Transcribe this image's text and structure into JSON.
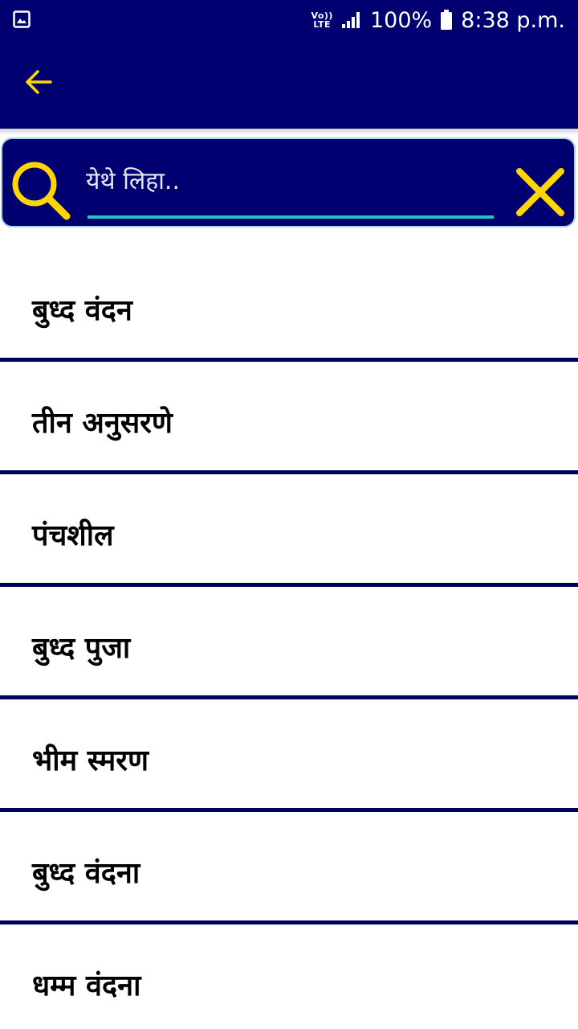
{
  "status_bar": {
    "gallery_icon": "image-icon",
    "volte_top": "Vo))",
    "volte_bottom": "LTE",
    "signal_icon": "signal-icon",
    "battery_percent": "100%",
    "battery_icon": "battery-icon",
    "time": "8:38 p.m."
  },
  "app_bar": {
    "back_icon": "arrow-left-icon",
    "accent_color": "#FFD600",
    "background_color": "#000070"
  },
  "search": {
    "placeholder": "येथे लिहा..",
    "value": "",
    "search_icon": "search-icon",
    "clear_icon": "close-icon",
    "underline_color": "#1FC7C9"
  },
  "list": {
    "items": [
      {
        "label": "बुध्द  वंदन"
      },
      {
        "label": "तीन अनुसरणे"
      },
      {
        "label": "पंचशील"
      },
      {
        "label": "बुध्द पुजा"
      },
      {
        "label": "भीम स्मरण"
      },
      {
        "label": "बुध्द वंदना"
      },
      {
        "label": "धम्म वंदना"
      }
    ]
  }
}
